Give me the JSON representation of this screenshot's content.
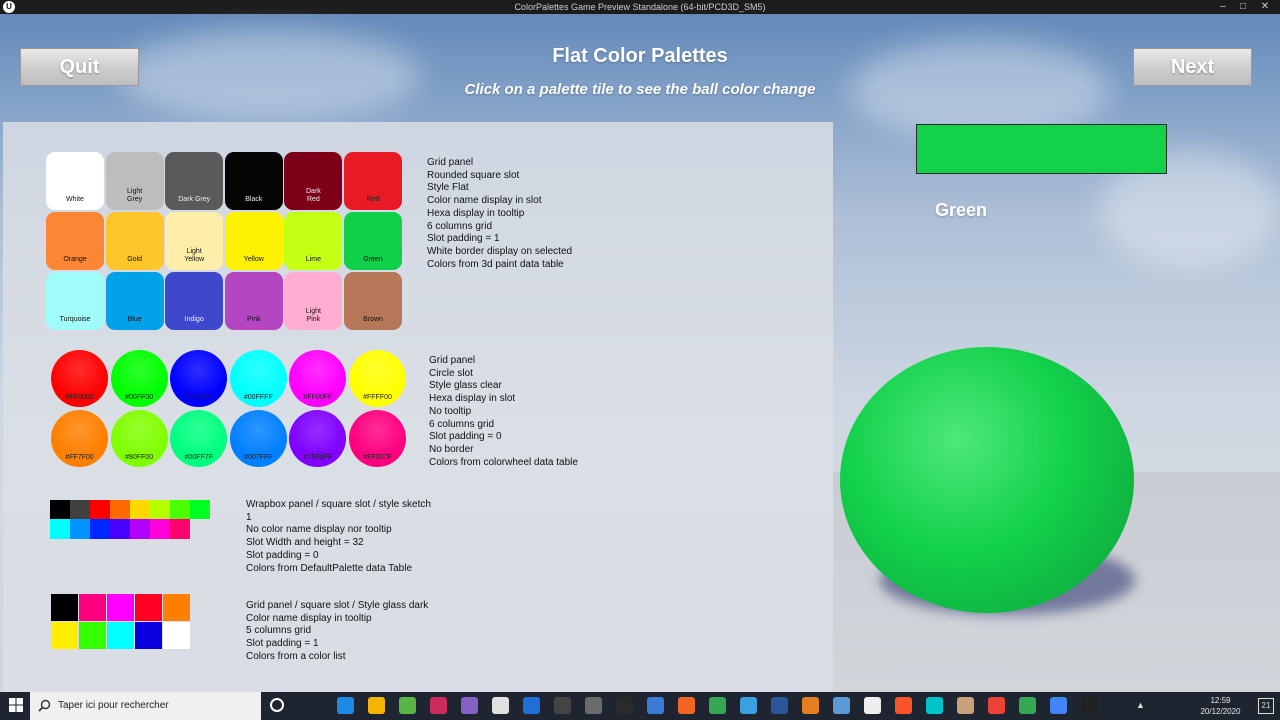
{
  "window": {
    "title": "ColorPalettes Game Preview Standalone (64-bit/PCD3D_SM5)",
    "logo": "ue-logo"
  },
  "header": {
    "quit_label": "Quit",
    "next_label": "Next",
    "title": "Flat Color Palettes",
    "subtitle": "Click on a palette tile to see the ball color change"
  },
  "palette1": {
    "tiles": [
      {
        "label": "White",
        "color": "#ffffff",
        "text": "#111"
      },
      {
        "label": "Light\nGrey",
        "color": "#bdbdbd",
        "text": "#111"
      },
      {
        "label": "Dark Grey",
        "color": "#5a5a5a",
        "text": "#eee"
      },
      {
        "label": "Black",
        "color": "#050505",
        "text": "#eee"
      },
      {
        "label": "Dark\nRed",
        "color": "#7d0018",
        "text": "#eee"
      },
      {
        "label": "Red",
        "color": "#e81a26",
        "text": "#222"
      },
      {
        "label": "Orange",
        "color": "#fb8634",
        "text": "#111"
      },
      {
        "label": "Gold",
        "color": "#fec62a",
        "text": "#111"
      },
      {
        "label": "Light\nYellow",
        "color": "#ffeeaa",
        "text": "#111"
      },
      {
        "label": "Yellow",
        "color": "#fff200",
        "text": "#111"
      },
      {
        "label": "Lime",
        "color": "#c4ff14",
        "text": "#111"
      },
      {
        "label": "Green",
        "color": "#10cf48",
        "text": "#111"
      },
      {
        "label": "Turquoise",
        "color": "#9ffcf8",
        "text": "#111"
      },
      {
        "label": "Blue",
        "color": "#02a2ea",
        "text": "#111"
      },
      {
        "label": "Indigo",
        "color": "#3e48cc",
        "text": "#eee"
      },
      {
        "label": "Pink",
        "color": "#b446c2",
        "text": "#111"
      },
      {
        "label": "Light\nPink",
        "color": "#ffadd1",
        "text": "#111"
      },
      {
        "label": "Brown",
        "color": "#b7785a",
        "text": "#111"
      }
    ],
    "description": "Grid panel\nRounded square slot\nStyle Flat\nColor name display in slot\nHexa display in tooltip\n6 columns grid\nSlot padding = 1\nWhite border display on selected\nColors from 3d paint data table"
  },
  "palette2": {
    "circles": [
      {
        "label": "#FF0000",
        "color": "#ff0000"
      },
      {
        "label": "#00FF00",
        "color": "#00ff00"
      },
      {
        "label": "#0000FF",
        "color": "#0000ff"
      },
      {
        "label": "#00FFFF",
        "color": "#00ffff"
      },
      {
        "label": "#FF00FF",
        "color": "#ff00ff"
      },
      {
        "label": "#FFFF00",
        "color": "#ffff00"
      },
      {
        "label": "#FF7F00",
        "color": "#ff7f00"
      },
      {
        "label": "#80FF00",
        "color": "#80ff00"
      },
      {
        "label": "#00FF7F",
        "color": "#00ff7f"
      },
      {
        "label": "#007FFF",
        "color": "#007fff"
      },
      {
        "label": "#7F00FF",
        "color": "#7f00ff"
      },
      {
        "label": "#FF007F",
        "color": "#ff007f"
      }
    ],
    "description": "Grid panel\nCircle slot\nStyle glass clear\nHexa display in slot\nNo tooltip\n6 columns grid\nSlot padding = 0\nNo border\nColors from colorwheel data table"
  },
  "palette3": {
    "row1": [
      "#000000",
      "#404040",
      "#ff0000",
      "#ff6a00",
      "#ffd800",
      "#b6ff00",
      "#4cff00",
      "#00ff21"
    ],
    "row2": [
      "#00ffff",
      "#0094ff",
      "#0026ff",
      "#4800ff",
      "#b200ff",
      "#ff00dc",
      "#ff006e"
    ],
    "description": "Wrapbox panel / square slot / style sketch\n1\nNo color name display nor tooltip\nSlot Width and height = 32\nSlot padding = 0\nColors from DefaultPalette data Table"
  },
  "palette4": {
    "row1": [
      "#000000",
      "#ff0080",
      "#ff00ff",
      "#ff0022",
      "#ff8000"
    ],
    "row2": [
      "#ffee00",
      "#33ff00",
      "#00ffff",
      "#0a00e0",
      "#ffffff"
    ],
    "description": "Grid panel / square slot / Style glass dark\nColor name display in tooltip\n5 columns grid\nSlot padding = 1\nColors from a color list"
  },
  "preview": {
    "color": "#12d14b",
    "name": "Green"
  },
  "taskbar": {
    "search_placeholder": "Taper ici pour rechercher",
    "time": "12:59",
    "date": "20/12/2020",
    "notif_count": "21"
  }
}
